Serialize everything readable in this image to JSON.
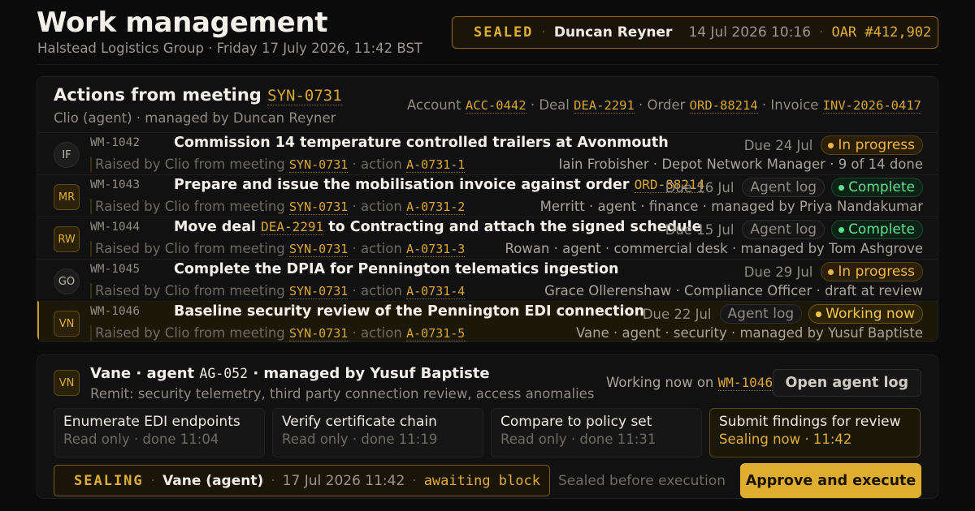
{
  "header": {
    "title": "Work management",
    "subtitle": "Halstead Logistics Group · Friday 17 July 2026, 11:42 BST"
  },
  "seal": {
    "status": "SEALED",
    "user": "Duncan Reyner",
    "timestamp": "14 Jul 2026 10:16",
    "ref": "OAR #412,902"
  },
  "actions": {
    "title_prefix": "Actions from meeting",
    "meeting_id": "SYN-0731",
    "subtitle": "Clio (agent) · managed by Duncan Reyner",
    "refs": {
      "account_label": "Account",
      "account": "ACC-0442",
      "deal_label": "Deal",
      "deal": "DEA-2291",
      "order_label": "Order",
      "order": "ORD-88214",
      "invoice_label": "Invoice",
      "invoice": "INV-2026-0417"
    },
    "raised_prefix": "Raised by Clio from meeting",
    "action_label": "action",
    "log_label": "Agent log",
    "rows": [
      {
        "avatar": "IF",
        "id": "WM-1042",
        "title": "Commission 14 temperature controlled trailers at Avonmouth",
        "meeting": "SYN-0731",
        "action": "A-0731-1",
        "due": "Due 24 Jul",
        "status": "In progress",
        "meta": "Iain Frobisher · Depot Network Manager · 9 of 14 done"
      },
      {
        "avatar": "MR",
        "id": "WM-1043",
        "title": "Prepare and issue the mobilisation invoice against order",
        "title_ref": "ORD-88214",
        "meeting": "SYN-0731",
        "action": "A-0731-2",
        "due": "Due 16 Jul",
        "status": "Complete",
        "meta": "Merritt · agent · finance · managed by Priya Nandakumar"
      },
      {
        "avatar": "RW",
        "id": "WM-1044",
        "title_pre": "Move deal",
        "title_ref": "DEA-2291",
        "title_post": "to Contracting and attach the signed schedule",
        "meeting": "SYN-0731",
        "action": "A-0731-3",
        "due": "Due 15 Jul",
        "status": "Complete",
        "meta": "Rowan · agent · commercial desk · managed by Tom Ashgrove"
      },
      {
        "avatar": "GO",
        "id": "WM-1045",
        "title": "Complete the DPIA for Pennington telematics ingestion",
        "meeting": "SYN-0731",
        "action": "A-0731-4",
        "due": "Due 29 Jul",
        "status": "In progress",
        "meta": "Grace Ollerenshaw · Compliance Officer · draft at review"
      },
      {
        "avatar": "VN",
        "id": "WM-1046",
        "title": "Baseline security review of the Pennington EDI connection",
        "meeting": "SYN-0731",
        "action": "A-0731-5",
        "due": "Due 22 Jul",
        "status": "Working now",
        "meta": "Vane · agent · security · managed by Yusuf Baptiste"
      }
    ]
  },
  "agent": {
    "avatar": "VN",
    "name_pre": "Vane · agent",
    "agent_id": "AG-052",
    "name_post": "· managed by Yusuf Baptiste",
    "remit": "Remit: security telemetry, third party connection review, access anomalies",
    "working_on_label": "Working now on",
    "working_on_id": "WM-1046",
    "open_log": "Open agent log",
    "steps": [
      {
        "label": "Enumerate EDI endpoints",
        "status": "Read only · done 11:04"
      },
      {
        "label": "Verify certificate chain",
        "status": "Read only · done 11:19"
      },
      {
        "label": "Compare to policy set",
        "status": "Read only · done 11:31"
      },
      {
        "label": "Submit findings for review",
        "status": "Sealing now · 11:42"
      }
    ],
    "sealing": {
      "status": "SEALING",
      "agent": "Vane (agent)",
      "timestamp": "17 Jul 2026 11:42",
      "state": "awaiting block"
    },
    "sealed_note": "Sealed before execution",
    "approve": "Approve and execute"
  },
  "colors": {
    "accent": "#e0ae2e",
    "complete": "#5fe08c",
    "progress": "#f0b545",
    "background": "#0b0b0b"
  },
  "icons": {
    "seal": "shield-check-icon"
  }
}
